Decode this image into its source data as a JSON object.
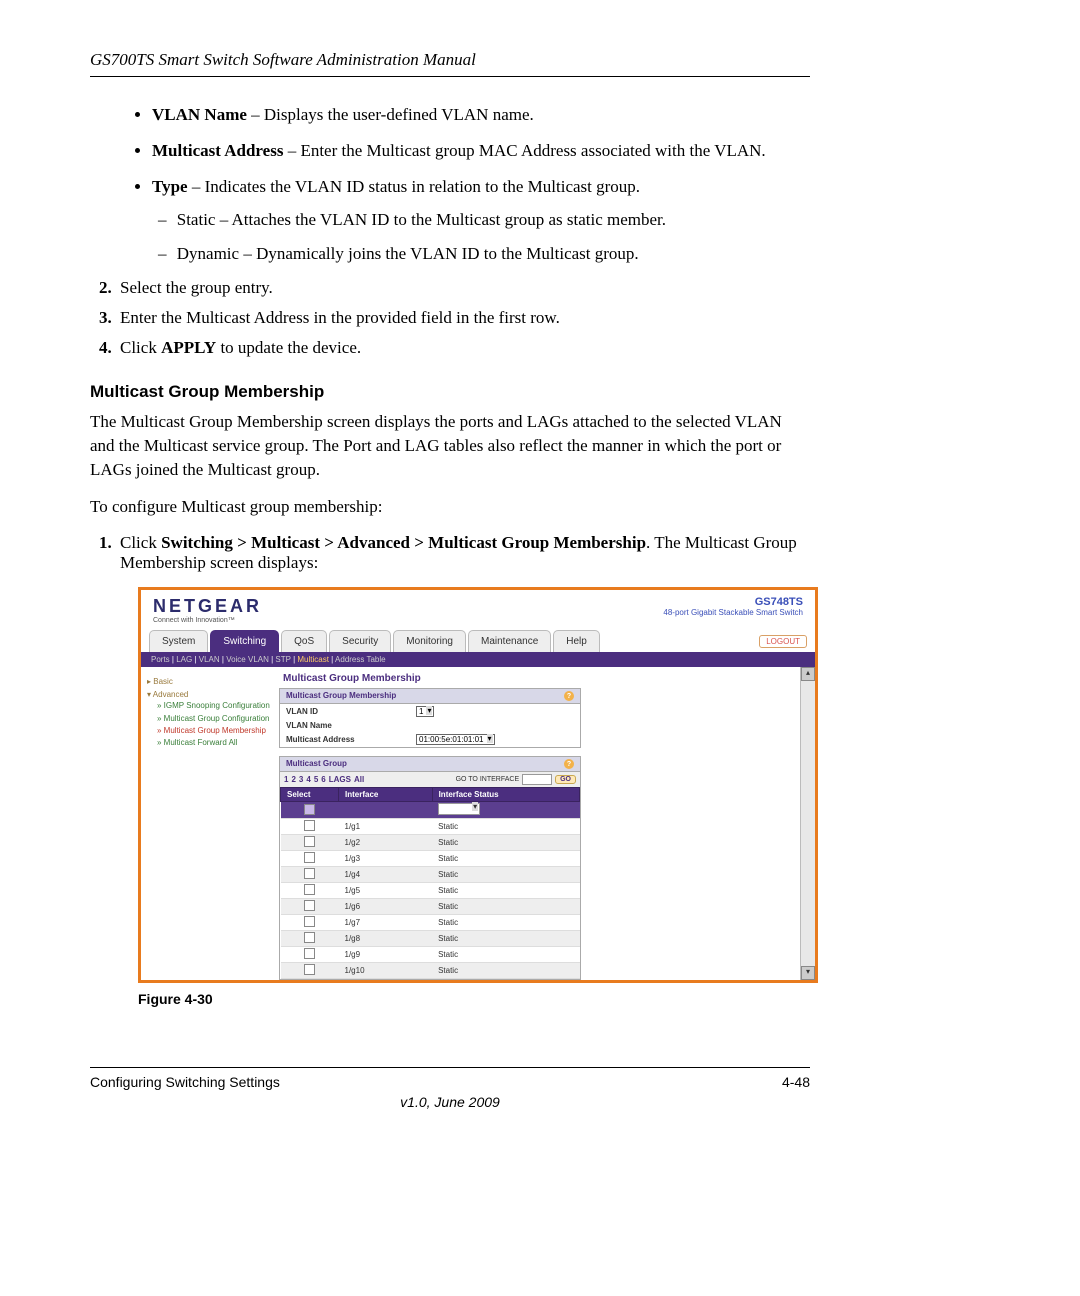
{
  "header": "GS700TS Smart Switch Software Administration Manual",
  "bullets": {
    "b1_term": "VLAN Name",
    "b1_desc": " – Displays the user-defined VLAN name.",
    "b2_term": "Multicast Address",
    "b2_desc": " – Enter the Multicast group MAC Address associated with the VLAN.",
    "b3_term": "Type",
    "b3_desc": " – Indicates the VLAN ID status in relation to the Multicast group.",
    "b3_sub1": "Static – Attaches the VLAN ID to the Multicast group as static member.",
    "b3_sub2": "Dynamic – Dynamically joins the VLAN ID to the Multicast group."
  },
  "steps": {
    "s2": "Select the group entry.",
    "s3": "Enter the Multicast Address in the provided field in the first row.",
    "s4_a": "Click ",
    "s4_b": "APPLY",
    "s4_c": " to update the device."
  },
  "section_title": "Multicast Group Membership",
  "para1": "The Multicast Group Membership screen displays the ports and LAGs attached to the selected VLAN and the Multicast service group. The Port and LAG tables also reflect the manner in which the port or LAGs joined the Multicast group.",
  "para2": "To configure Multicast group membership:",
  "step1_a": "Click ",
  "step1_b": "Switching > Multicast > Advanced > Multicast Group Membership",
  "step1_c": ". The Multicast Group Membership screen displays:",
  "shot": {
    "logo": "NETGEAR",
    "logo_sub": "Connect with Innovation™",
    "model": "GS748TS",
    "model_sub": "48-port Gigabit Stackable Smart Switch",
    "tabs": [
      "System",
      "Switching",
      "QoS",
      "Security",
      "Monitoring",
      "Maintenance",
      "Help"
    ],
    "active_tab": "Switching",
    "logout": "LOGOUT",
    "subnav_items": [
      "Ports",
      "LAG",
      "VLAN",
      "Voice VLAN",
      "STP",
      "Multicast",
      "Address Table"
    ],
    "subnav_sel": "Multicast",
    "sidebar": {
      "grp1": "Basic",
      "grp2": "Advanced",
      "items": [
        "IGMP Snooping Configuration",
        "Multicast Group Configuration",
        "Multicast Group Membership",
        "Multicast Forward All"
      ],
      "current": "Multicast Group Membership"
    },
    "main_title": "Multicast Group Membership",
    "panel1": {
      "head": "Multicast Group Membership",
      "row1_label": "VLAN ID",
      "row1_val": "1",
      "row2_label": "VLAN Name",
      "row3_label": "Multicast Address",
      "row3_val": "01:00:5e:01:01:01"
    },
    "panel2": {
      "head": "Multicast Group",
      "pager": [
        "1",
        "2",
        "3",
        "4",
        "5",
        "6",
        "LAGS",
        "All"
      ],
      "goto_label": "GO TO INTERFACE",
      "go": "GO",
      "cols": [
        "Select",
        "Interface",
        "Interface Status"
      ],
      "rows": [
        {
          "if": "1/g1",
          "st": "Static"
        },
        {
          "if": "1/g2",
          "st": "Static"
        },
        {
          "if": "1/g3",
          "st": "Static"
        },
        {
          "if": "1/g4",
          "st": "Static"
        },
        {
          "if": "1/g5",
          "st": "Static"
        },
        {
          "if": "1/g6",
          "st": "Static"
        },
        {
          "if": "1/g7",
          "st": "Static"
        },
        {
          "if": "1/g8",
          "st": "Static"
        },
        {
          "if": "1/g9",
          "st": "Static"
        },
        {
          "if": "1/g10",
          "st": "Static"
        }
      ]
    }
  },
  "figure_caption": "Figure 4-30",
  "footer_left": "Configuring Switching Settings",
  "footer_right": "4-48",
  "footer_center": "v1.0, June 2009"
}
